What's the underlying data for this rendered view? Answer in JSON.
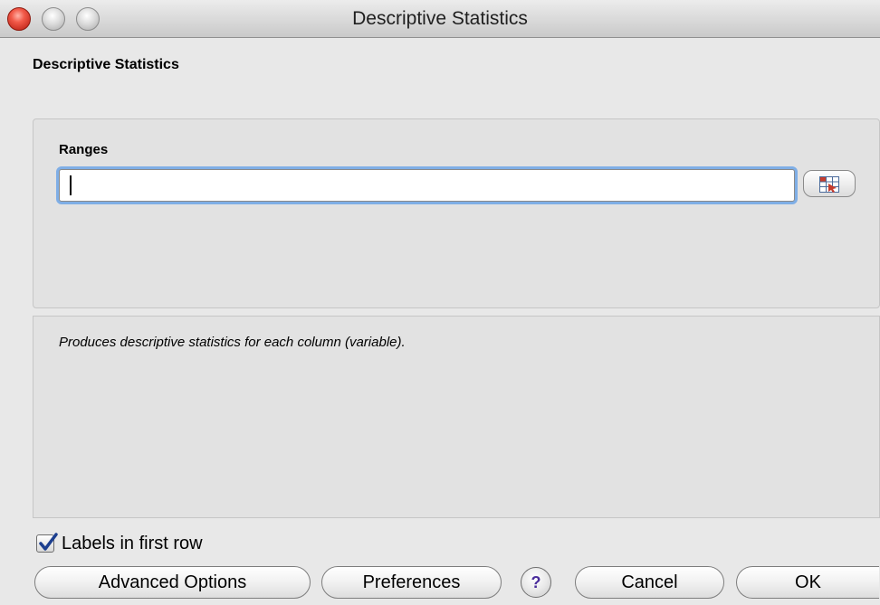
{
  "window": {
    "title": "Descriptive Statistics"
  },
  "dialog": {
    "heading": "Descriptive Statistics"
  },
  "ranges": {
    "label": "Ranges",
    "value": ""
  },
  "description": "Produces descriptive statistics for each column (variable).",
  "options": {
    "labels_in_first_row": "Labels in first row",
    "labels_checked": true
  },
  "buttons": {
    "advanced": "Advanced Options",
    "preferences": "Preferences",
    "help": "?",
    "cancel": "Cancel",
    "ok": "OK"
  },
  "icons": {
    "close": "close-icon",
    "minimize": "minimize-icon",
    "zoom": "zoom-icon",
    "range_picker": "range-select-icon",
    "checkmark": "checkmark-icon",
    "help": "help-icon"
  },
  "colors": {
    "focus_ring": "#7faee6",
    "close_button": "#e0473a",
    "help_glyph": "#4b2d9c"
  }
}
